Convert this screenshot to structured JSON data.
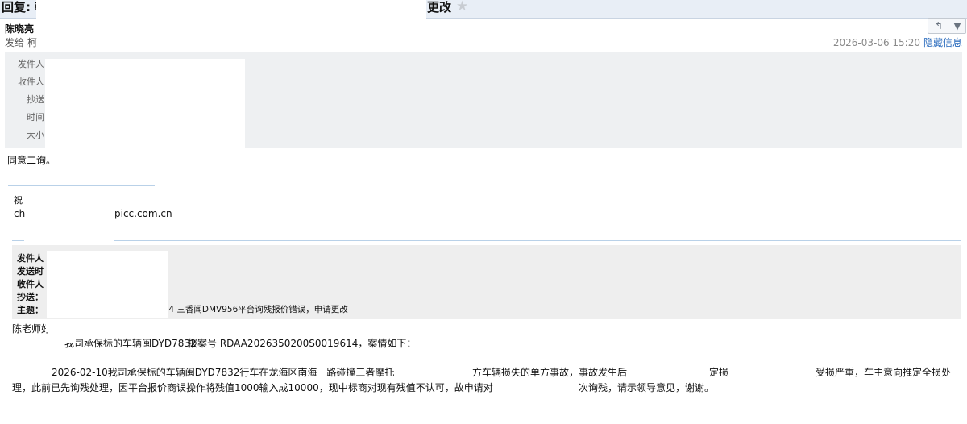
{
  "title": {
    "prefix": "回复: 韩",
    "suffix": "更改"
  },
  "message": {
    "sender_name": "陈晓亮",
    "send_to": "发给 柯",
    "datetime": "2026-03-06 15:20",
    "hide_info_label": "隐藏信息"
  },
  "toolbar": {
    "reply_icon": "reply-arrow-icon",
    "more_icon": "chevron-down-icon"
  },
  "header_fields": {
    "from_label": "发件人",
    "to_label": "收件人",
    "cc_label": "抄送",
    "time_label": "时间",
    "size_label": "大小"
  },
  "body": {
    "reply_text": "同意二询。",
    "signature_line1": "祝",
    "signature_email_prefix": "ch",
    "signature_email_domain": "picc.com.cn"
  },
  "quoted": {
    "from_label": "发件人",
    "sent_label": "发送时",
    "to_label": "收件人",
    "cc_label": "抄送：",
    "subject_label": "主题：",
    "subject_text": "514 三香闻DMV956平台询残报价错误，申请更改",
    "greeting": "陈老师好",
    "line1_left": "我司承保标的车辆闽DYD7832",
    "line1_right": "报案号  RDAA2026350200S0019614，案情如下：",
    "line2_a": "2026-02-10我司承保标的车辆闽DYD7832行车在龙海区南海一路碰撞三者摩托",
    "line2_b": "方车辆损失的单方事故，事故发生后",
    "line2_c": "定损",
    "line2_d": "受损严重，车主意向推定全损处",
    "line3_a": "理，此前已先询残处理，因平台报价商误操作将残值1000输入成10000，现中标商对现有残值不认可，故申请对",
    "line3_b": "次询残，请示领导意见，谢谢。"
  }
}
